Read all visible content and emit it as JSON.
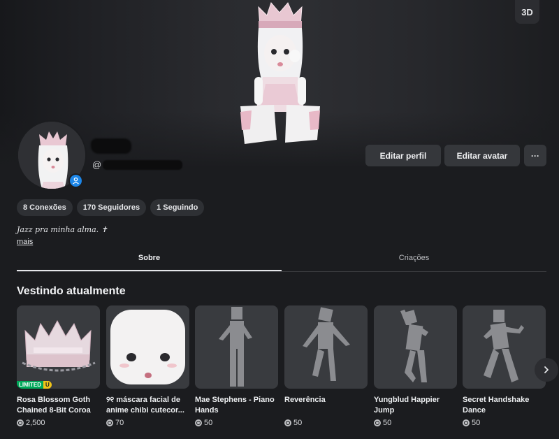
{
  "stage": {
    "view_toggle_label": "3D"
  },
  "profile": {
    "username_prefix": "@",
    "verified_icon": "user-badge-icon",
    "accent_color": "#1c86e8"
  },
  "actions": {
    "edit_profile_label": "Editar perfil",
    "edit_avatar_label": "Editar avatar",
    "more_label": "···"
  },
  "stats": {
    "connections": "8 Conexões",
    "followers": "170 Seguidores",
    "following": "1 Seguindo"
  },
  "about": {
    "bio": "Jazz pra minha alma. ✝",
    "more_link": "mais"
  },
  "tabs": [
    {
      "label": "Sobre",
      "active": true
    },
    {
      "label": "Criações",
      "active": false
    }
  ],
  "wearing": {
    "title": "Vestindo atualmente",
    "items": [
      {
        "name": "Rosa Blossom Goth Chained 8-Bit Coroa",
        "price": "2,500",
        "badge_limited": "LIMITED",
        "badge_u": "U"
      },
      {
        "name": "୨୧ máscara facial de anime chibi cutecor...",
        "price": "70"
      },
      {
        "name": "Mae Stephens - Piano Hands",
        "price": "50"
      },
      {
        "name": "Reverência",
        "price": "50"
      },
      {
        "name": "Yungblud Happier Jump",
        "price": "50"
      },
      {
        "name": "Secret Handshake Dance",
        "price": "50"
      }
    ]
  }
}
